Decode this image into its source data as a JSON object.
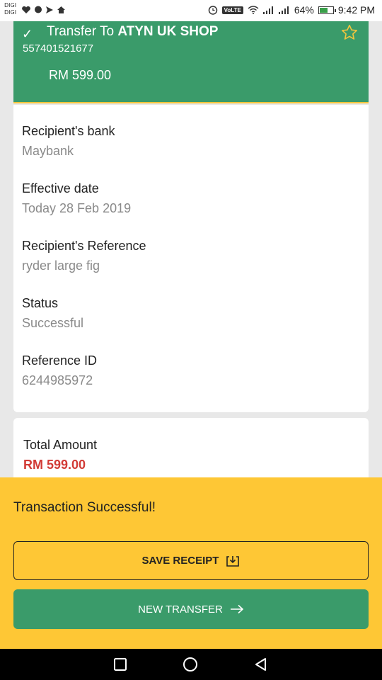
{
  "status_bar": {
    "carrier1": "DIGI",
    "carrier2": "DIGI",
    "volte": "VoLTE",
    "battery_percent": "64%",
    "battery_level": 0.64,
    "time": "9:42 PM"
  },
  "header": {
    "transfer_prefix": "Transfer To",
    "recipient_name": "ATYN UK SHOP",
    "account_number": "557401521677",
    "amount": "RM 599.00",
    "icons": {
      "status": "check-icon",
      "favorite": "star-icon"
    }
  },
  "details": [
    {
      "label": "Recipient's bank",
      "value": "Maybank"
    },
    {
      "label": "Effective date",
      "value": "Today 28 Feb 2019"
    },
    {
      "label": "Recipient's Reference",
      "value": "ryder large fig"
    },
    {
      "label": "Status",
      "value": "Successful"
    },
    {
      "label": "Reference ID",
      "value": "6244985972"
    }
  ],
  "total": {
    "label": "Total Amount",
    "value": "RM 599.00"
  },
  "sheet": {
    "message": "Transaction Successful!",
    "save_label": "SAVE RECEIPT",
    "new_label": "NEW TRANSFER"
  },
  "colors": {
    "brand_green": "#3a9b6a",
    "accent_yellow": "#fec735",
    "amount_red": "#d23b36"
  },
  "nav": {
    "icons": [
      "recents-icon",
      "home-icon",
      "back-icon"
    ]
  }
}
